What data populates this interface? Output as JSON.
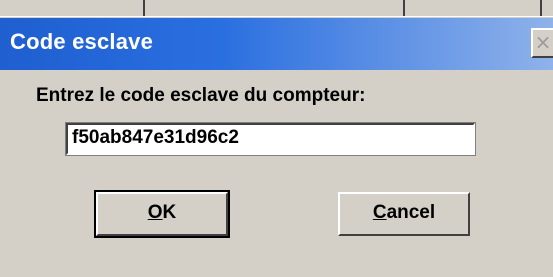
{
  "dialog": {
    "title": "Code esclave",
    "close_glyph": "×",
    "prompt": "Entrez le code esclave du compteur:",
    "code_value": "f50ab847e31d96c2",
    "ok_label": "OK",
    "ok_underline": "O",
    "ok_rest": "K",
    "cancel_label": "Cancel",
    "cancel_underline": "C",
    "cancel_rest": "ancel"
  },
  "colors": {
    "title_bar_start": "#1f5fd0",
    "title_bar_end": "#8fb2ea",
    "dialog_bg": "#d4d0c8"
  }
}
